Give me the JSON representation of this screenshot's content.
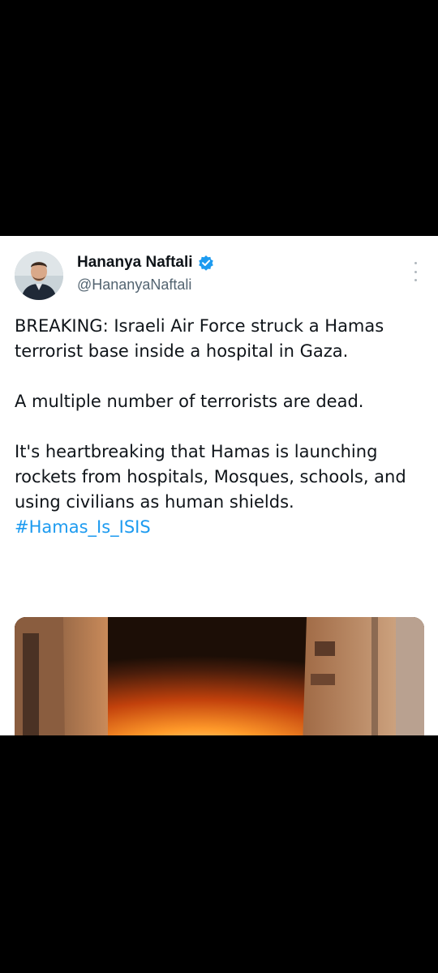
{
  "tweet": {
    "display_name": "Hananya Naftali",
    "handle": "@HananyaNaftali",
    "paragraphs": [
      "BREAKING: Israeli Air Force struck a Hamas terrorist base inside a hospital in Gaza.",
      "A multiple number of terrorists are dead."
    ],
    "paragraph3_text": "It's heartbreaking that Hamas is launching rockets from hospitals, Mosques, schools, and using civilians as human shields.",
    "hashtag": "#Hamas_Is_ISIS"
  },
  "colors": {
    "text_primary": "#0f1419",
    "text_secondary": "#536471",
    "link": "#1d9bf0",
    "verified_badge": "#1d9bf0",
    "background": "#ffffff",
    "letterbox": "#000000"
  },
  "icons": {
    "verified": "verified-badge-icon",
    "more": "more-options-icon"
  }
}
